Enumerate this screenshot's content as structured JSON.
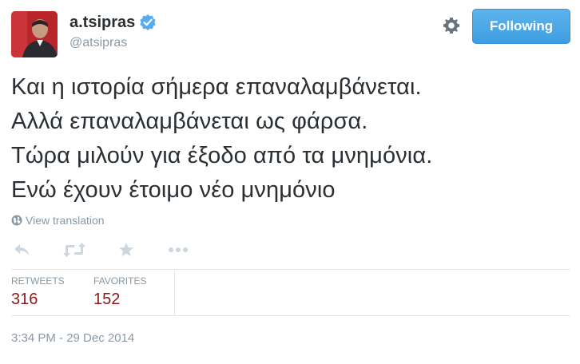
{
  "user": {
    "display_name": "a.tsipras",
    "handle": "@atsipras",
    "verified": true,
    "avatar_icon": "profile-photo"
  },
  "header": {
    "settings_icon": "gear-icon",
    "follow_label": "Following"
  },
  "tweet": {
    "lines": [
      "Και η ιστορία σήμερα επαναλαμβάνεται.",
      "Αλλά επαναλαμβάνεται ως φάρσα.",
      "Τώρα μιλούν για έξοδο από τα μνημόνια.",
      "Ενώ έχουν έτοιμο νέο μνημόνιο"
    ],
    "translation_label": "View translation"
  },
  "actions": {
    "reply_icon": "reply-icon",
    "retweet_icon": "retweet-icon",
    "favorite_icon": "star-icon",
    "more_icon": "more-icon"
  },
  "stats": {
    "retweets_label": "RETWEETS",
    "retweets_value": "316",
    "favorites_label": "FAVORITES",
    "favorites_value": "152"
  },
  "timestamp": "3:34 PM - 29 Dec 2014",
  "colors": {
    "accent": "#55acee",
    "follow_button": "#4ca7e7",
    "stat_value": "#8a1a1f",
    "muted": "#8899a6",
    "divider": "#e1e8ed"
  }
}
